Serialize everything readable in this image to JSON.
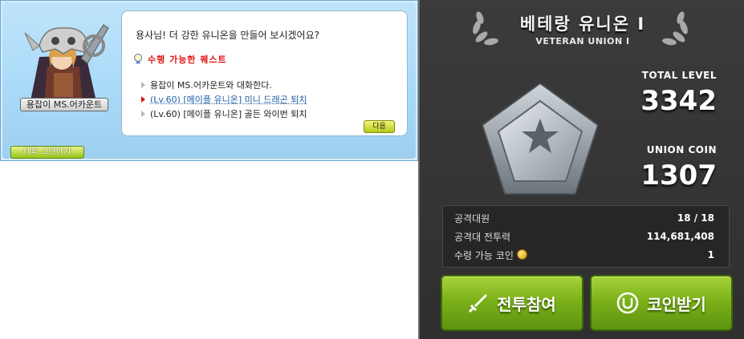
{
  "npc_dialog": {
    "npc_name": "용잡이 MS.어카운트",
    "message": "용사님! 더 강한 유니온을 만들어 보시겠어요?",
    "quest_header": "수행 가능한 퀘스트",
    "quests": [
      {
        "text": "용잡이 MS.어카운트와 대화한다.",
        "active": false
      },
      {
        "text": "(Lv.60) [메이플 유니온] 미니 드래곤 퇴치",
        "active": true
      },
      {
        "text": "(Lv.60) [메이플 유니온] 골든 와이번 퇴치",
        "active": false
      }
    ],
    "next_label": "다음",
    "end_chat_label": "대화 그만하기"
  },
  "union": {
    "title": "베테랑 유니온 I",
    "subtitle": "VETERAN UNION Ⅰ",
    "total_level_label": "TOTAL LEVEL",
    "total_level": "3342",
    "union_coin_label": "UNION COIN",
    "union_coin": "1307",
    "info": [
      {
        "label": "공격대원",
        "value": "18 / 18"
      },
      {
        "label": "공격대 전투력",
        "value": "114,681,408"
      },
      {
        "label": "수령 가능 코인",
        "value": "1"
      }
    ],
    "battle_button": "전투참여",
    "coin_button": "코인받기"
  },
  "colors": {
    "quest_red": "#e01313",
    "quest_link": "#2060a8",
    "button_green": "#7cb11a",
    "panel_dark": "#333333"
  },
  "icons": [
    "npc-portrait",
    "lightbulb-icon",
    "bullet-arrow-icon",
    "laurel-wreath",
    "silver-pentagon-emblem",
    "coin-icon",
    "sword-icon",
    "union-coin-icon"
  ]
}
